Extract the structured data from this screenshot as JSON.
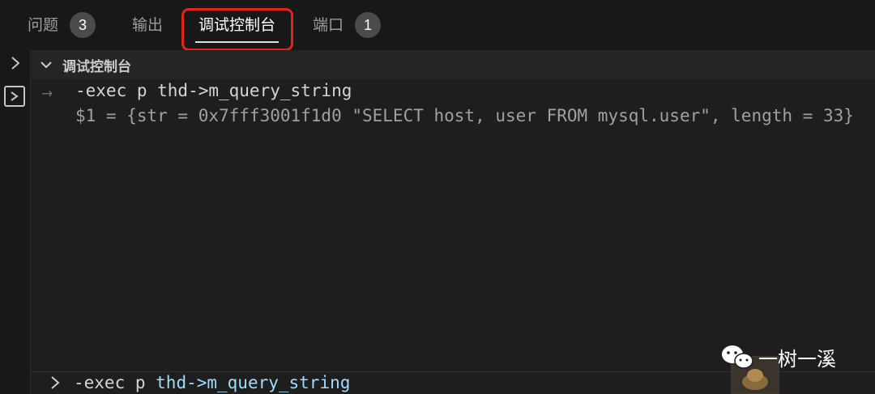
{
  "tabs": [
    {
      "label": "问题",
      "badge": "3"
    },
    {
      "label": "输出"
    },
    {
      "label": "调试控制台",
      "active": true
    },
    {
      "label": "端口",
      "badge": "1"
    }
  ],
  "section": {
    "title": "调试控制台"
  },
  "console": {
    "command": "-exec p thd->m_query_string",
    "result": "$1 = {str = 0x7fff3001f1d0 \"SELECT host, user FROM mysql.user\", length = 33}"
  },
  "input": {
    "prefix": "-exec p ",
    "highlight": "thd->m_query_string"
  },
  "watermark": {
    "text": "一树一溪"
  },
  "colors": {
    "highlight_box": "#e2231a",
    "background": "#1e1e1e",
    "tabbar": "#181818"
  }
}
